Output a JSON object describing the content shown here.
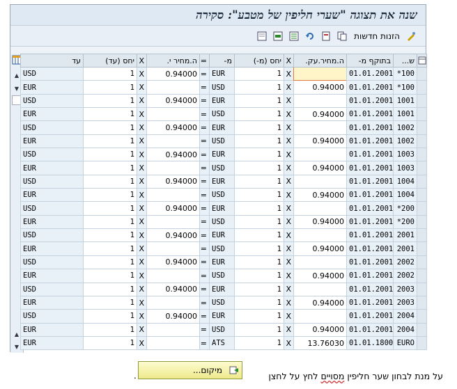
{
  "window": {
    "title": "שנה את תצוגה \"שערי חליפין של מטבע\": סקירה"
  },
  "toolbar": {
    "new_entries_label": "הזנות חדשות"
  },
  "table": {
    "headers": [
      "ש...",
      "בתוקף מ-",
      "ה.מחיר.עק.",
      "X",
      "יחס (מ-)",
      "מ-",
      "=",
      "ה.מחיר י.",
      "X",
      "יחס (עד)",
      "עד"
    ],
    "rows": [
      [
        "*100",
        "01.01.2001",
        "",
        "X",
        "1",
        "EUR",
        "=",
        "0.94000",
        "X",
        "1",
        "USD"
      ],
      [
        "*100",
        "01.01.2001",
        "0.94000",
        "X",
        "1",
        "USD",
        "=",
        "",
        "X",
        "1",
        "EUR"
      ],
      [
        "1001",
        "01.01.2001",
        "",
        "X",
        "1",
        "EUR",
        "=",
        "0.94000",
        "X",
        "1",
        "USD"
      ],
      [
        "1001",
        "01.01.2001",
        "0.94000",
        "X",
        "1",
        "USD",
        "=",
        "",
        "X",
        "1",
        "EUR"
      ],
      [
        "1002",
        "01.01.2001",
        "",
        "X",
        "1",
        "EUR",
        "=",
        "0.94000",
        "X",
        "1",
        "USD"
      ],
      [
        "1002",
        "01.01.2001",
        "0.94000",
        "X",
        "1",
        "USD",
        "=",
        "",
        "X",
        "1",
        "EUR"
      ],
      [
        "1003",
        "01.01.2001",
        "",
        "X",
        "1",
        "EUR",
        "=",
        "0.94000",
        "X",
        "1",
        "USD"
      ],
      [
        "1003",
        "01.01.2001",
        "0.94000",
        "X",
        "1",
        "USD",
        "=",
        "",
        "X",
        "1",
        "EUR"
      ],
      [
        "1004",
        "01.01.2001",
        "",
        "X",
        "1",
        "EUR",
        "=",
        "0.94000",
        "X",
        "1",
        "USD"
      ],
      [
        "1004",
        "01.01.2001",
        "0.94000",
        "X",
        "1",
        "USD",
        "=",
        "",
        "X",
        "1",
        "EUR"
      ],
      [
        "*200",
        "01.01.2001",
        "",
        "X",
        "1",
        "EUR",
        "=",
        "0.94000",
        "X",
        "1",
        "USD"
      ],
      [
        "*200",
        "01.01.2001",
        "0.94000",
        "X",
        "1",
        "USD",
        "=",
        "",
        "X",
        "1",
        "EUR"
      ],
      [
        "2001",
        "01.01.2001",
        "",
        "X",
        "1",
        "EUR",
        "=",
        "0.94000",
        "X",
        "1",
        "USD"
      ],
      [
        "2001",
        "01.01.2001",
        "0.94000",
        "X",
        "1",
        "USD",
        "=",
        "",
        "X",
        "1",
        "EUR"
      ],
      [
        "2002",
        "01.01.2001",
        "",
        "X",
        "1",
        "EUR",
        "=",
        "0.94000",
        "X",
        "1",
        "USD"
      ],
      [
        "2002",
        "01.01.2001",
        "0.94000",
        "X",
        "1",
        "USD",
        "=",
        "",
        "X",
        "1",
        "EUR"
      ],
      [
        "2003",
        "01.01.2001",
        "",
        "X",
        "1",
        "EUR",
        "=",
        "0.94000",
        "X",
        "1",
        "USD"
      ],
      [
        "2003",
        "01.01.2001",
        "0.94000",
        "X",
        "1",
        "USD",
        "=",
        "",
        "X",
        "1",
        "EUR"
      ],
      [
        "2004",
        "01.01.2001",
        "",
        "X",
        "1",
        "EUR",
        "=",
        "0.94000",
        "X",
        "1",
        "USD"
      ],
      [
        "2004",
        "01.01.2001",
        "0.94000",
        "X",
        "1",
        "USD",
        "=",
        "",
        "X",
        "1",
        "EUR"
      ],
      [
        "EURO",
        "01.01.1800",
        "13.76030",
        "X",
        "1",
        "ATS",
        "=",
        "",
        "X",
        "1",
        "EUR"
      ]
    ]
  },
  "footer": {
    "instruction_prefix": "על מנת לבחון שער חליפין",
    "instruction_squiggly": "מסויים",
    "instruction_suffix": "לחץ על לחצן",
    "trailing_period": ".",
    "position_button_label": "מיקום..."
  },
  "colors": {
    "title_bar": "#dfe9f3",
    "cell_readonly": "#e8f0f8",
    "cell_editable": "#ffffff",
    "cell_focus": "#fff5c8",
    "button_yellow": "#eee98a"
  }
}
